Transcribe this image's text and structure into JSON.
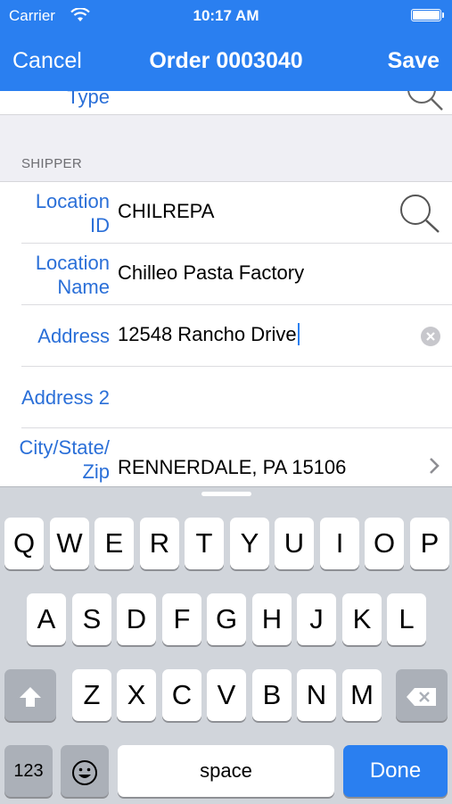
{
  "status_bar": {
    "carrier": "Carrier",
    "time": "10:17 AM",
    "battery_level": 1.0
  },
  "nav": {
    "cancel_label": "Cancel",
    "title": "Order 0003040",
    "save_label": "Save"
  },
  "form": {
    "partial_row_label": "Type",
    "section_header": "SHIPPER",
    "rows": [
      {
        "label_line1": "Location",
        "label_line2": "ID",
        "value": "CHILREPA",
        "icon": "search-icon"
      },
      {
        "label_line1": "Location",
        "label_line2": "Name",
        "value": "Chilleo Pasta Factory"
      },
      {
        "label": "Address",
        "value": "12548 Rancho Drive",
        "icon": "clear-icon",
        "focused": true
      },
      {
        "label": "Address 2",
        "value": ""
      },
      {
        "label_line1": "City/State/",
        "label_line2": "Zip",
        "value": "RENNERDALE, PA 15106",
        "icon": "chevron-right-icon"
      }
    ]
  },
  "keyboard": {
    "row1": [
      "Q",
      "W",
      "E",
      "R",
      "T",
      "Y",
      "U",
      "I",
      "O",
      "P"
    ],
    "row2": [
      "A",
      "S",
      "D",
      "F",
      "G",
      "H",
      "J",
      "K",
      "L"
    ],
    "row3": [
      "Z",
      "X",
      "C",
      "V",
      "B",
      "N",
      "M"
    ],
    "numbers_label": "123",
    "space_label": "space",
    "done_label": "Done",
    "shift_icon": "shift-icon",
    "delete_icon": "delete-icon",
    "emoji_icon": "emoji-icon"
  },
  "colors": {
    "accent": "#2a7ff0",
    "label_blue": "#2a6fd8",
    "keyboard_bg": "#d1d5db"
  }
}
